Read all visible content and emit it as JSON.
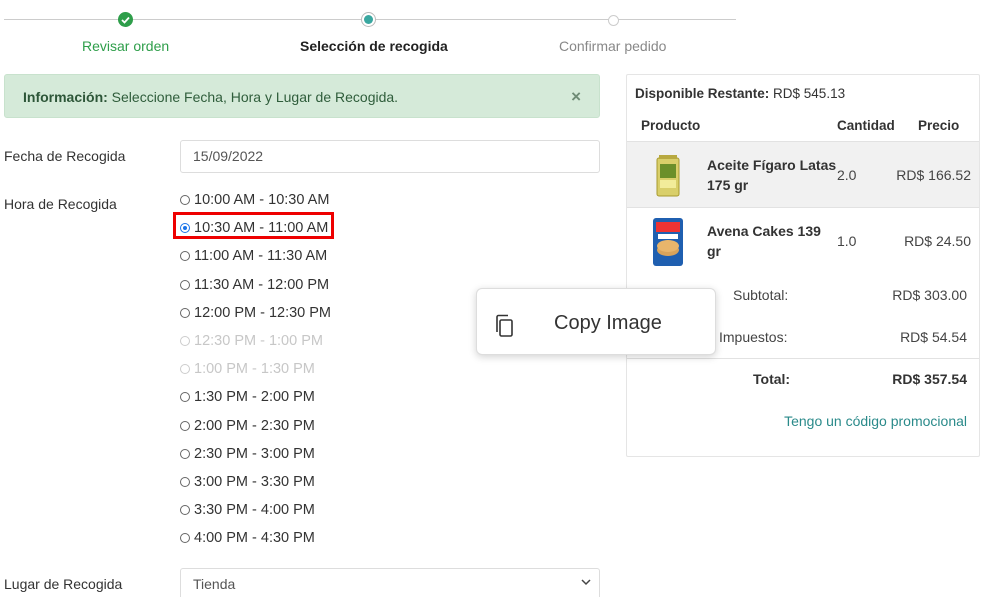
{
  "stepper": {
    "steps": [
      {
        "label": "Revisar orden",
        "state": "done"
      },
      {
        "label": "Selección de recogida",
        "state": "current"
      },
      {
        "label": "Confirmar pedido",
        "state": "pending"
      }
    ],
    "colors": {
      "done": "#2e9e4a",
      "current": "#3aa7a0",
      "pending": "#888888"
    }
  },
  "alert": {
    "title": "Información:",
    "message": " Seleccione Fecha, Hora y Lugar de Recogida.",
    "close": "×"
  },
  "form": {
    "date_label": "Fecha de Recogida",
    "date_value": "15/09/2022",
    "time_label": "Hora de Recogida",
    "time_slots": [
      {
        "label": "10:00 AM - 10:30 AM",
        "checked": false,
        "disabled": false
      },
      {
        "label": "10:30 AM - 11:00 AM",
        "checked": true,
        "disabled": false
      },
      {
        "label": "11:00 AM - 11:30 AM",
        "checked": false,
        "disabled": false
      },
      {
        "label": "11:30 AM - 12:00 PM",
        "checked": false,
        "disabled": false
      },
      {
        "label": "12:00 PM - 12:30 PM",
        "checked": false,
        "disabled": false
      },
      {
        "label": "12:30 PM - 1:00 PM",
        "checked": false,
        "disabled": true
      },
      {
        "label": "1:00 PM - 1:30 PM",
        "checked": false,
        "disabled": true
      },
      {
        "label": "1:30 PM - 2:00 PM",
        "checked": false,
        "disabled": false
      },
      {
        "label": "2:00 PM - 2:30 PM",
        "checked": false,
        "disabled": false
      },
      {
        "label": "2:30 PM - 3:00 PM",
        "checked": false,
        "disabled": false
      },
      {
        "label": "3:00 PM - 3:30 PM",
        "checked": false,
        "disabled": false
      },
      {
        "label": "3:30 PM - 4:00 PM",
        "checked": false,
        "disabled": false
      },
      {
        "label": "4:00 PM - 4:30 PM",
        "checked": false,
        "disabled": false
      }
    ],
    "place_label": "Lugar de Recogida",
    "place_value": "Tienda"
  },
  "order": {
    "available_label": "Disponible Restante:",
    "available_value": " RD$ 545.13",
    "headers": {
      "product": "Producto",
      "quantity": "Cantidad",
      "price": "Precio"
    },
    "items": [
      {
        "name": "Aceite Fígaro Latas 175 gr",
        "quantity": "2.0",
        "price": "RD$ 166.52",
        "image": "olive-oil-can-icon"
      },
      {
        "name": "Avena Cakes 139 gr",
        "quantity": "1.0",
        "price": "RD$ 24.50",
        "image": "oat-cakes-package-icon"
      }
    ],
    "subtotal_label": "Subtotal:",
    "subtotal_value": "RD$ 303.00",
    "tax_label": "Impuestos:",
    "tax_value": "RD$ 54.54",
    "total_label": "Total:",
    "total_value": "RD$ 357.54",
    "promo_link": "Tengo un código promocional"
  },
  "context_menu": {
    "item_label": "Copy Image",
    "item_icon": "copy-icon"
  }
}
